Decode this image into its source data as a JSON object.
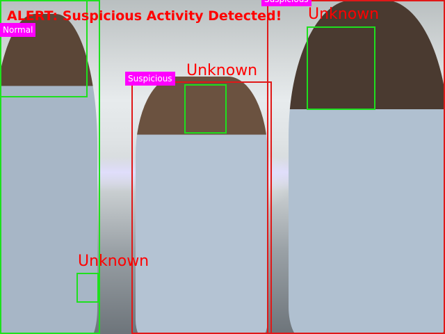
{
  "alert_text": "ALERT: Suspicious Activity Detected!",
  "colors": {
    "box_green": "#1ee01e",
    "box_red": "#e01818",
    "tag_bg": "#ff00ff",
    "label_text": "#ff0000"
  },
  "tags": [
    {
      "text": "Normal"
    },
    {
      "text": "Suspicious"
    },
    {
      "text": "Suspicious"
    }
  ],
  "face_labels": [
    {
      "text": "Unknown"
    },
    {
      "text": "Unknown"
    },
    {
      "text": "Unknown"
    }
  ]
}
